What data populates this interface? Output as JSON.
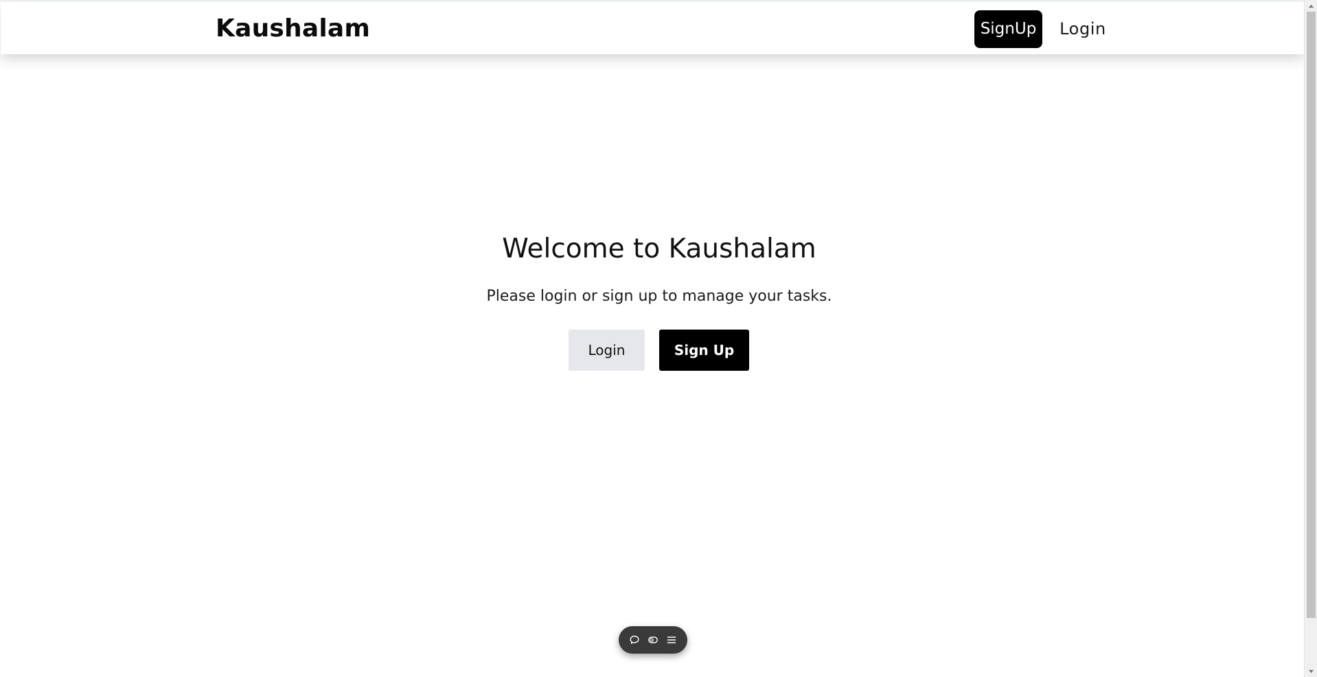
{
  "navbar": {
    "brand": "Kaushalam",
    "signup_label": "SignUp",
    "login_label": "Login"
  },
  "hero": {
    "title": "Welcome to Kaushalam",
    "subtitle": "Please login or sign up to manage your tasks.",
    "login_label": "Login",
    "signup_label": "Sign Up"
  },
  "floating_toolbar": {
    "icons": [
      "chat-bubble-icon",
      "eye-toggle-icon",
      "hamburger-menu-icon"
    ]
  },
  "colors": {
    "primary": "#000000",
    "secondary_button": "#e5e7eb",
    "toolbar": "#3a3a3a",
    "background": "#ffffff"
  }
}
